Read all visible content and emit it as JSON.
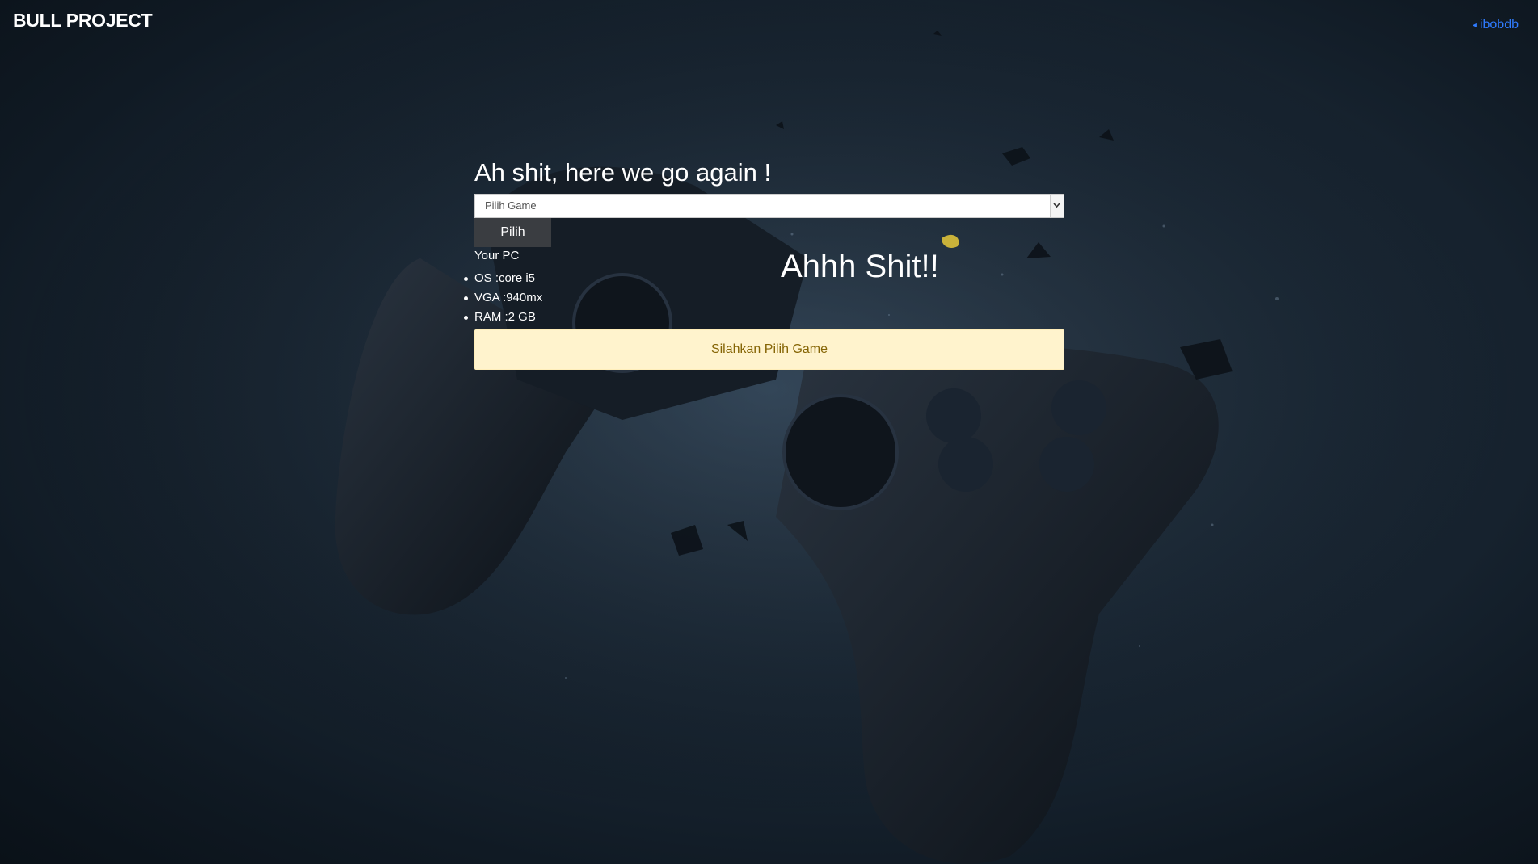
{
  "header": {
    "brand": "BULL PROJECT",
    "user_link": "ibobdb",
    "user_link_icon": "chevron-left-icon"
  },
  "main": {
    "title": "Ah shit, here we go again !",
    "game_select": {
      "selected": "Pilih Game",
      "arrow_icon": "chevron-down-icon"
    },
    "pick_button": "Pilih",
    "pc_label": "Your PC",
    "specs": [
      "OS :core i5",
      "VGA :940mx",
      "RAM :2 GB"
    ],
    "alert": "Silahkan Pilih Game",
    "big_text": "Ahhh Shit!!"
  },
  "colors": {
    "background": "#1c2a38",
    "link": "#2f7bff",
    "alert_bg": "#fff3cd",
    "alert_text": "#856404",
    "button_bg": "#3a3d41"
  }
}
